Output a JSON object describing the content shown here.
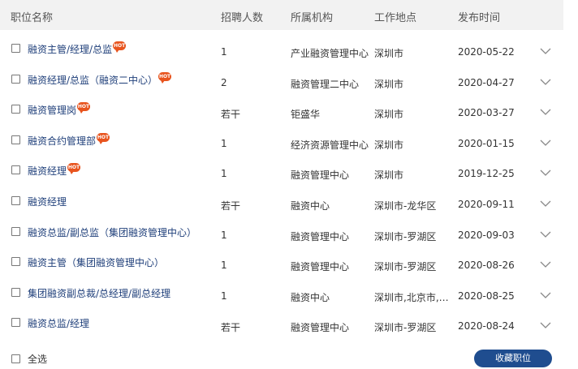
{
  "header": {
    "title": "职位名称",
    "count": "招聘人数",
    "org": "所属机构",
    "location": "工作地点",
    "date": "发布时间"
  },
  "hot_badge": "HOT",
  "rows": [
    {
      "title": "融资主管/经理/总监",
      "hot": true,
      "count": "1",
      "org": "产业融资管理中心",
      "location": "深圳市",
      "date": "2020-05-22"
    },
    {
      "title": "融资经理/总监（融资二中心）",
      "hot": true,
      "count": "2",
      "org": "融资管理二中心",
      "location": "深圳市",
      "date": "2020-04-27"
    },
    {
      "title": "融资管理岗",
      "hot": true,
      "count": "若干",
      "org": "钜盛华",
      "location": "深圳市",
      "date": "2020-03-27"
    },
    {
      "title": "融资合约管理部",
      "hot": true,
      "count": "1",
      "org": "经济资源管理中心",
      "location": "深圳市",
      "date": "2020-01-15"
    },
    {
      "title": "融资经理",
      "hot": true,
      "count": "1",
      "org": "融资管理中心",
      "location": "深圳市",
      "date": "2019-12-25"
    },
    {
      "title": "融资经理",
      "hot": false,
      "count": "若干",
      "org": "融资中心",
      "location": "深圳市-龙华区",
      "date": "2020-09-11"
    },
    {
      "title": "融资总监/副总监（集团融资管理中心）",
      "hot": false,
      "count": "1",
      "org": "融资管理中心",
      "location": "深圳市-罗湖区",
      "date": "2020-09-03"
    },
    {
      "title": "融资主管（集团融资管理中心）",
      "hot": false,
      "count": "1",
      "org": "融资管理中心",
      "location": "深圳市-罗湖区",
      "date": "2020-08-26"
    },
    {
      "title": "集团融资副总裁/总经理/副总经理",
      "hot": false,
      "count": "1",
      "org": "融资中心",
      "location": "深圳市,北京市,上...",
      "date": "2020-08-25"
    },
    {
      "title": "融资总监/经理",
      "hot": false,
      "count": "若干",
      "org": "融资管理中心",
      "location": "深圳市-罗湖区",
      "date": "2020-08-24"
    }
  ],
  "footer": {
    "select_all": "全选",
    "save_button": "收藏职位"
  },
  "colors": {
    "link": "#1f3f7a",
    "hot_badge": "#e8541e",
    "button": "#1f4d8f",
    "header_bg": "#f2f2f2"
  },
  "icons": {
    "row_toggle": "chevron-down-icon",
    "checkbox": "checkbox-icon"
  }
}
